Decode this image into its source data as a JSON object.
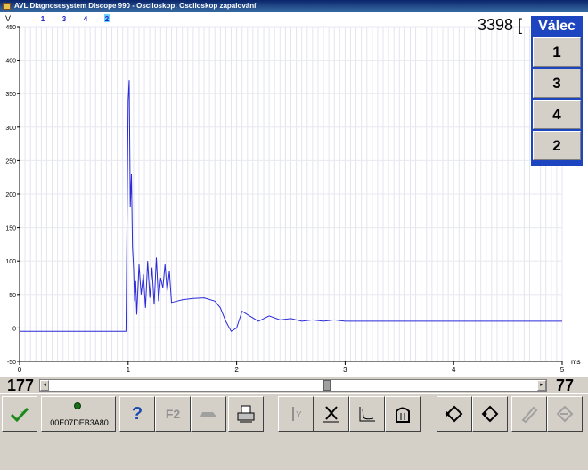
{
  "window": {
    "title": "AVL Diagnosesystem Discope 990 - Osciloskop: Osciloskop zapalování"
  },
  "scope": {
    "y_unit": "V",
    "x_unit": "ms",
    "channel_tabs": [
      "1",
      "3",
      "4",
      "2"
    ],
    "active_channel": "2",
    "rpm_readout": "3398 [",
    "trace_color": "#2a2ad8"
  },
  "cylinders": {
    "header": "Válec",
    "items": [
      "1",
      "3",
      "4",
      "2"
    ]
  },
  "scroll": {
    "left_value": "177",
    "right_value": "77",
    "position": 0.56
  },
  "toolbar": {
    "device_id": "00E07DEB3A80",
    "f2_label": "F2",
    "help_label": "?"
  },
  "chart_data": {
    "type": "line",
    "ylabel": "V",
    "xlabel": "ms",
    "xlim": [
      0,
      5
    ],
    "ylim": [
      -50,
      450
    ],
    "x_ticks": [
      "0",
      "1",
      "2",
      "3",
      "4",
      "5"
    ],
    "y_ticks": [
      "450",
      "400",
      "350",
      "300",
      "250",
      "200",
      "150",
      "100",
      "50",
      "0",
      "-50"
    ],
    "series": [
      {
        "x": [
          0,
          0.98,
          1.0,
          1.01,
          1.02,
          1.03,
          1.04,
          1.05,
          1.06,
          1.07,
          1.08,
          1.1,
          1.12,
          1.14,
          1.16,
          1.18,
          1.2,
          1.22,
          1.24,
          1.26,
          1.28,
          1.3,
          1.32,
          1.34,
          1.36,
          1.38,
          1.4,
          1.45,
          1.5,
          1.6,
          1.7,
          1.8,
          1.85,
          1.9,
          1.95,
          2.0,
          2.05,
          2.1,
          2.2,
          2.3,
          2.4,
          2.5,
          2.6,
          2.7,
          2.8,
          2.9,
          3.0,
          3.5,
          4.0,
          4.5,
          5.0
        ],
        "y": [
          -5,
          -5,
          340,
          370,
          180,
          230,
          120,
          90,
          40,
          70,
          20,
          95,
          50,
          80,
          30,
          100,
          45,
          90,
          35,
          105,
          40,
          75,
          60,
          95,
          55,
          85,
          38,
          40,
          42,
          44,
          45,
          40,
          30,
          10,
          -5,
          0,
          25,
          20,
          10,
          18,
          12,
          14,
          10,
          12,
          10,
          12,
          10,
          10,
          10,
          10,
          10
        ]
      }
    ]
  }
}
